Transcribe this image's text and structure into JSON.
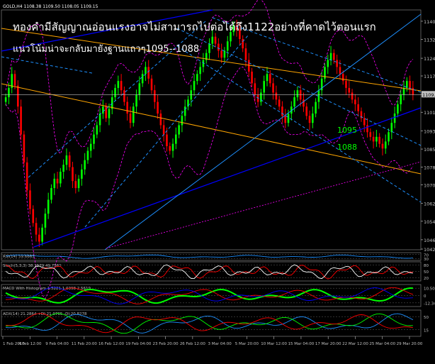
{
  "header": {
    "symbol_line": "GOLD,H4  1108.38 1109.50 1108.05 1109.15",
    "annotation_line1": "ทองคำมีสัญญาณอ่อนแรงอาจไม่สามารถไปต่อได้ถึง1122อย่างที่คาดไว้ตอนแรก",
    "annotation_line2": "แนวโน้มน่าจะกลับมายังฐานแถวๆ1095--1088",
    "target_label_1": "1095",
    "target_label_2": "1088"
  },
  "colors": {
    "background": "#000000",
    "bull_candle": "#00ff00",
    "bear_candle": "#ff0000",
    "channel_orange": "#ffa500",
    "channel_blue": "#0000ff",
    "channel_lightblue": "#1e90ff",
    "band_magenta": "#ff00ff",
    "annotation_text": "#ffffff",
    "target_label": "#00ff00"
  },
  "chart_data": {
    "type": "candlestick",
    "symbol": "GOLD",
    "timeframe": "H4",
    "price_axis": {
      "ylim": [
        1042.5,
        1145.5
      ],
      "tick_labels": [
        "1140.65",
        "1132.85",
        "1124.75",
        "1117.15",
        "1109.15",
        "1101.55",
        "1093.55",
        "1085.75",
        "1078.00",
        "1070.35",
        "1062.40",
        "1054.75",
        "1046.80",
        "1042.80"
      ]
    },
    "current_price_label": "1109.15",
    "time_axis": {
      "tick_labels": [
        "1 Feb 2010",
        "4 Feb 12:00",
        "9 Feb 04:00",
        "11 Feb 20:00",
        "16 Feb 12:00",
        "19 Feb 04:00",
        "23 Feb 20:00",
        "26 Feb 12:00",
        "3 Mar 04:00",
        "5 Mar 20:00",
        "10 Mar 12:00",
        "15 Mar 04:00",
        "17 Mar 20:00",
        "22 Mar 12:00",
        "25 Mar 04:00",
        "29 Mar 20:00"
      ]
    },
    "closes": [
      1108,
      1112,
      1118,
      1113,
      1104,
      1092,
      1080,
      1068,
      1060,
      1054,
      1049,
      1046,
      1052,
      1058,
      1064,
      1069,
      1073,
      1071,
      1076,
      1079,
      1083,
      1078,
      1072,
      1069,
      1073,
      1077,
      1081,
      1085,
      1088,
      1092,
      1096,
      1101,
      1104,
      1099,
      1103,
      1108,
      1112,
      1115,
      1111,
      1106,
      1101,
      1097,
      1104,
      1109,
      1114,
      1118,
      1121,
      1116,
      1111,
      1106,
      1101,
      1096,
      1092,
      1087,
      1085,
      1088,
      1092,
      1096,
      1100,
      1104,
      1107,
      1111,
      1115,
      1118,
      1121,
      1124,
      1127,
      1131,
      1134,
      1131,
      1128,
      1125,
      1128,
      1132,
      1136,
      1139,
      1137,
      1133,
      1129,
      1124,
      1119,
      1114,
      1109,
      1106,
      1110,
      1115,
      1118,
      1114,
      1110,
      1107,
      1104,
      1100,
      1097,
      1101,
      1104,
      1108,
      1111,
      1107,
      1104,
      1100,
      1097,
      1101,
      1106,
      1111,
      1116,
      1121,
      1124,
      1127,
      1124,
      1121,
      1118,
      1115,
      1112,
      1110,
      1107,
      1105,
      1102,
      1099,
      1096,
      1093,
      1091,
      1089,
      1091,
      1088,
      1086,
      1089,
      1093,
      1097,
      1101,
      1105,
      1109,
      1112,
      1115,
      1112,
      1109
    ],
    "indicators": [
      {
        "label": "RSI(14) 59.6663",
        "levels": [
          "70",
          "30"
        ],
        "ylim": [
          0,
          100
        ]
      },
      {
        "label": "Stoch(5,3,3) 38.1579 49.7561",
        "levels": [
          "80",
          "50",
          "20"
        ],
        "ylim": [
          0,
          100
        ]
      },
      {
        "label": "MACD With Histogram 1.5221 1.0398 2.5619",
        "levels": [
          "10.5099",
          "0",
          "-12.342"
        ],
        "ylim": [
          -12.342,
          10.5099
        ]
      },
      {
        "label": "ADX(14) 21.2864 +DI:21.0765 -DI:20.8278",
        "levels": [
          "50",
          "15"
        ],
        "ylim": [
          0,
          100
        ]
      }
    ]
  }
}
